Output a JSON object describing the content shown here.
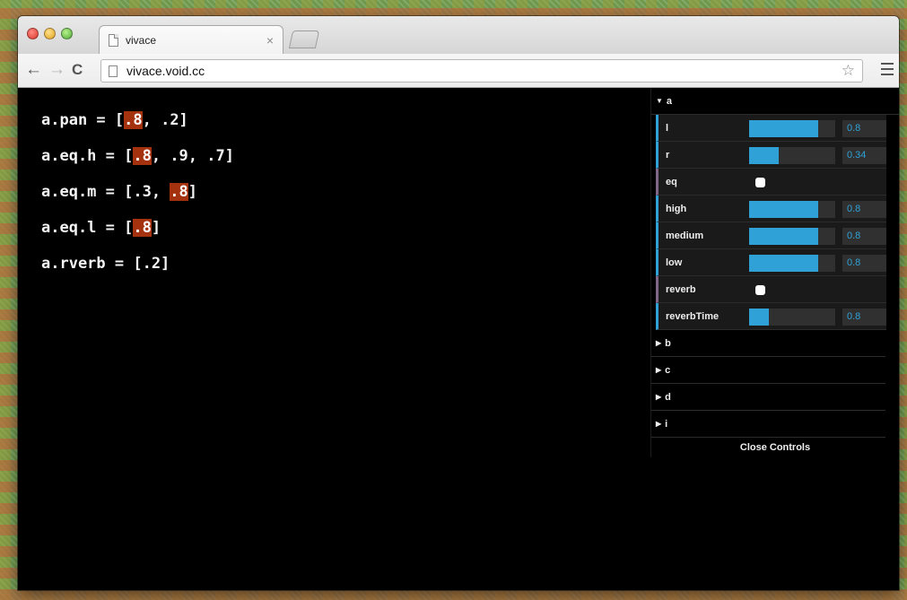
{
  "browser": {
    "tab_title": "vivace",
    "tab_close": "×",
    "url": "vivace.void.cc",
    "back": "←",
    "forward": "→",
    "reload": "C",
    "star": "☆"
  },
  "code": [
    [
      {
        "t": "a.pan = ["
      },
      {
        "t": ".8",
        "hl": true
      },
      {
        "t": ", .2]"
      }
    ],
    [
      {
        "t": "a.eq.h = ["
      },
      {
        "t": ".8",
        "hl": true
      },
      {
        "t": ", .9, .7]"
      }
    ],
    [
      {
        "t": "a.eq.m = [.3, "
      },
      {
        "t": ".8",
        "hl": true
      },
      {
        "t": "]"
      }
    ],
    [
      {
        "t": "a.eq.l = ["
      },
      {
        "t": ".8",
        "hl": true
      },
      {
        "t": "]"
      }
    ],
    [
      {
        "t": "a.rverb = [.2]"
      }
    ]
  ],
  "controls": {
    "open_folder": "a",
    "rows": [
      {
        "label": "l",
        "type": "slider",
        "value": "0.8",
        "fill": 0.8
      },
      {
        "label": "r",
        "type": "slider",
        "value": "0.34",
        "fill": 0.34
      },
      {
        "label": "eq",
        "type": "checkbox"
      },
      {
        "label": "high",
        "type": "slider",
        "value": "0.8",
        "fill": 0.8
      },
      {
        "label": "medium",
        "type": "slider",
        "value": "0.8",
        "fill": 0.8
      },
      {
        "label": "low",
        "type": "slider",
        "value": "0.8",
        "fill": 0.8
      },
      {
        "label": "reverb",
        "type": "checkbox"
      },
      {
        "label": "reverbTime",
        "type": "slider",
        "value": "0.8",
        "fill": 0.23
      }
    ],
    "closed_folders": [
      "b",
      "c",
      "d",
      "i"
    ],
    "close_label": "Close Controls"
  }
}
